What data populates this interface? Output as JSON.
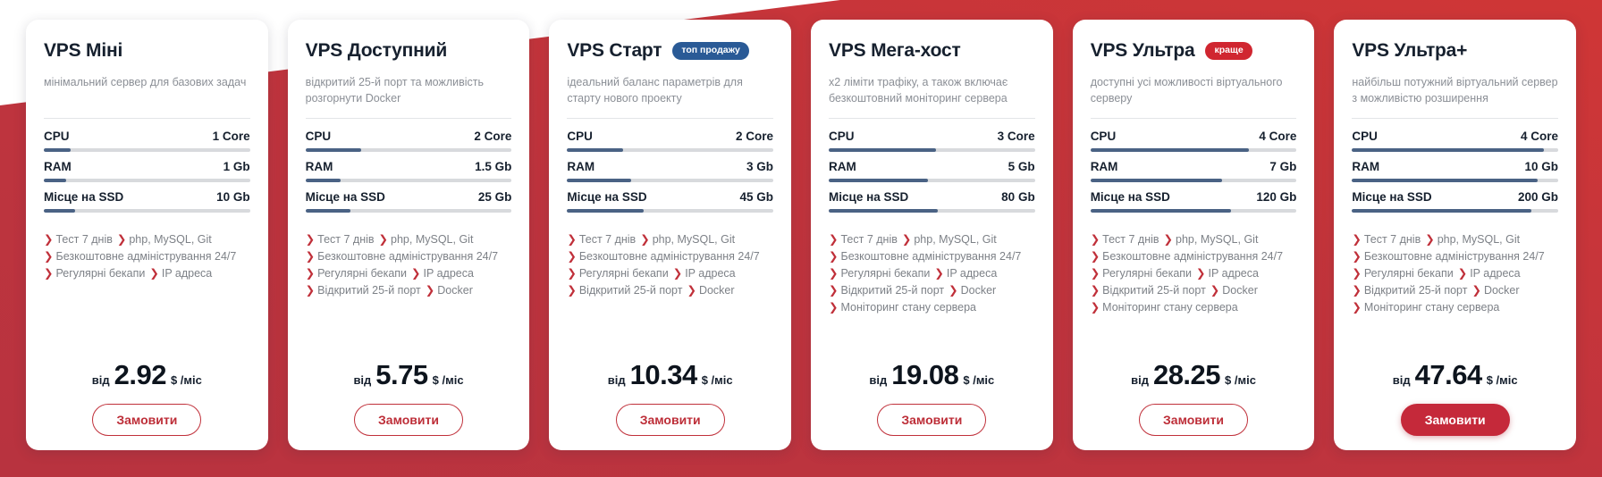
{
  "theme": {
    "accent_red": "#c0303a",
    "button_filled_red": "#c5293a",
    "badge_blue": "#2a5a96",
    "badge_red": "#d02630",
    "bar_fill": "#4a6284",
    "bar_track": "#d8dadd",
    "title_color": "#16202e",
    "desc_color": "#8b8f96",
    "card_bg": "#ffffff",
    "page_bg": "#ffffff"
  },
  "labels": {
    "chevron": "❯",
    "price_prefix": "від",
    "price_unit": "$ /міс",
    "order": "Замовити"
  },
  "cards": [
    {
      "title": "VPS Міні",
      "badge": null,
      "badge_color": null,
      "description": "мінімальний сервер для базових задач",
      "specs": [
        {
          "label": "CPU",
          "value": "1 Core",
          "pct": 13
        },
        {
          "label": "RAM",
          "value": "1 Gb",
          "pct": 11
        },
        {
          "label": "Місце на SSD",
          "value": "10 Gb",
          "pct": 15
        }
      ],
      "features": [
        [
          "Тест 7 днів",
          "php, MySQL, Git"
        ],
        [
          "Безкоштовне адміністрування 24/7"
        ],
        [
          "Регулярні бекапи",
          "IP адреса"
        ]
      ],
      "price": "2.92",
      "button_style": "outline"
    },
    {
      "title": "VPS Доступний",
      "badge": null,
      "badge_color": null,
      "description": "відкритий 25-й порт та можливість розгорнути Docker",
      "specs": [
        {
          "label": "CPU",
          "value": "2 Core",
          "pct": 27
        },
        {
          "label": "RAM",
          "value": "1.5 Gb",
          "pct": 17
        },
        {
          "label": "Місце на SSD",
          "value": "25 Gb",
          "pct": 22
        }
      ],
      "features": [
        [
          "Тест 7 днів",
          "php, MySQL, Git"
        ],
        [
          "Безкоштовне адміністрування 24/7"
        ],
        [
          "Регулярні бекапи",
          "IP адреса"
        ],
        [
          "Відкритий 25-й порт",
          "Docker"
        ]
      ],
      "price": "5.75",
      "button_style": "outline"
    },
    {
      "title": "VPS Старт",
      "badge": "топ продажу",
      "badge_color": "#2a5a96",
      "description": "ідеальний баланс параметрів для старту нового проекту",
      "specs": [
        {
          "label": "CPU",
          "value": "2 Core",
          "pct": 27
        },
        {
          "label": "RAM",
          "value": "3 Gb",
          "pct": 31
        },
        {
          "label": "Місце на SSD",
          "value": "45 Gb",
          "pct": 37
        }
      ],
      "features": [
        [
          "Тест 7 днів",
          "php, MySQL, Git"
        ],
        [
          "Безкоштовне адміністрування 24/7"
        ],
        [
          "Регулярні бекапи",
          "IP адреса"
        ],
        [
          "Відкритий 25-й порт",
          "Docker"
        ]
      ],
      "price": "10.34",
      "button_style": "outline"
    },
    {
      "title": "VPS Мега-хост",
      "badge": null,
      "badge_color": null,
      "description": "х2 ліміти трафіку, а також включає безкоштовний моніторинг сервера",
      "specs": [
        {
          "label": "CPU",
          "value": "3 Core",
          "pct": 52
        },
        {
          "label": "RAM",
          "value": "5 Gb",
          "pct": 48
        },
        {
          "label": "Місце на SSD",
          "value": "80 Gb",
          "pct": 53
        }
      ],
      "features": [
        [
          "Тест 7 днів",
          "php, MySQL, Git"
        ],
        [
          "Безкоштовне адміністрування 24/7"
        ],
        [
          "Регулярні бекапи",
          "IP адреса"
        ],
        [
          "Відкритий 25-й порт",
          "Docker"
        ],
        [
          "Моніторинг стану сервера"
        ]
      ],
      "price": "19.08",
      "button_style": "outline"
    },
    {
      "title": "VPS Ультра",
      "badge": "краще",
      "badge_color": "#d02630",
      "description": "доступні усі можливості віртуального серверу",
      "specs": [
        {
          "label": "CPU",
          "value": "4 Core",
          "pct": 77
        },
        {
          "label": "RAM",
          "value": "7 Gb",
          "pct": 64
        },
        {
          "label": "Місце на SSD",
          "value": "120 Gb",
          "pct": 68
        }
      ],
      "features": [
        [
          "Тест 7 днів",
          "php, MySQL, Git"
        ],
        [
          "Безкоштовне адміністрування 24/7"
        ],
        [
          "Регулярні бекапи",
          "IP адреса"
        ],
        [
          "Відкритий 25-й порт",
          "Docker"
        ],
        [
          "Моніторинг стану сервера"
        ]
      ],
      "price": "28.25",
      "button_style": "outline"
    },
    {
      "title": "VPS Ультра+",
      "badge": null,
      "badge_color": null,
      "description": "найбільш потужний віртуальний сервер з можливістю розширення",
      "specs": [
        {
          "label": "CPU",
          "value": "4 Core",
          "pct": 93
        },
        {
          "label": "RAM",
          "value": "10 Gb",
          "pct": 90
        },
        {
          "label": "Місце на SSD",
          "value": "200 Gb",
          "pct": 87
        }
      ],
      "features": [
        [
          "Тест 7 днів",
          "php, MySQL, Git"
        ],
        [
          "Безкоштовне адміністрування 24/7"
        ],
        [
          "Регулярні бекапи",
          "IP адреса"
        ],
        [
          "Відкритий 25-й порт",
          "Docker"
        ],
        [
          "Моніторинг стану сервера"
        ]
      ],
      "price": "47.64",
      "button_style": "filled"
    }
  ]
}
